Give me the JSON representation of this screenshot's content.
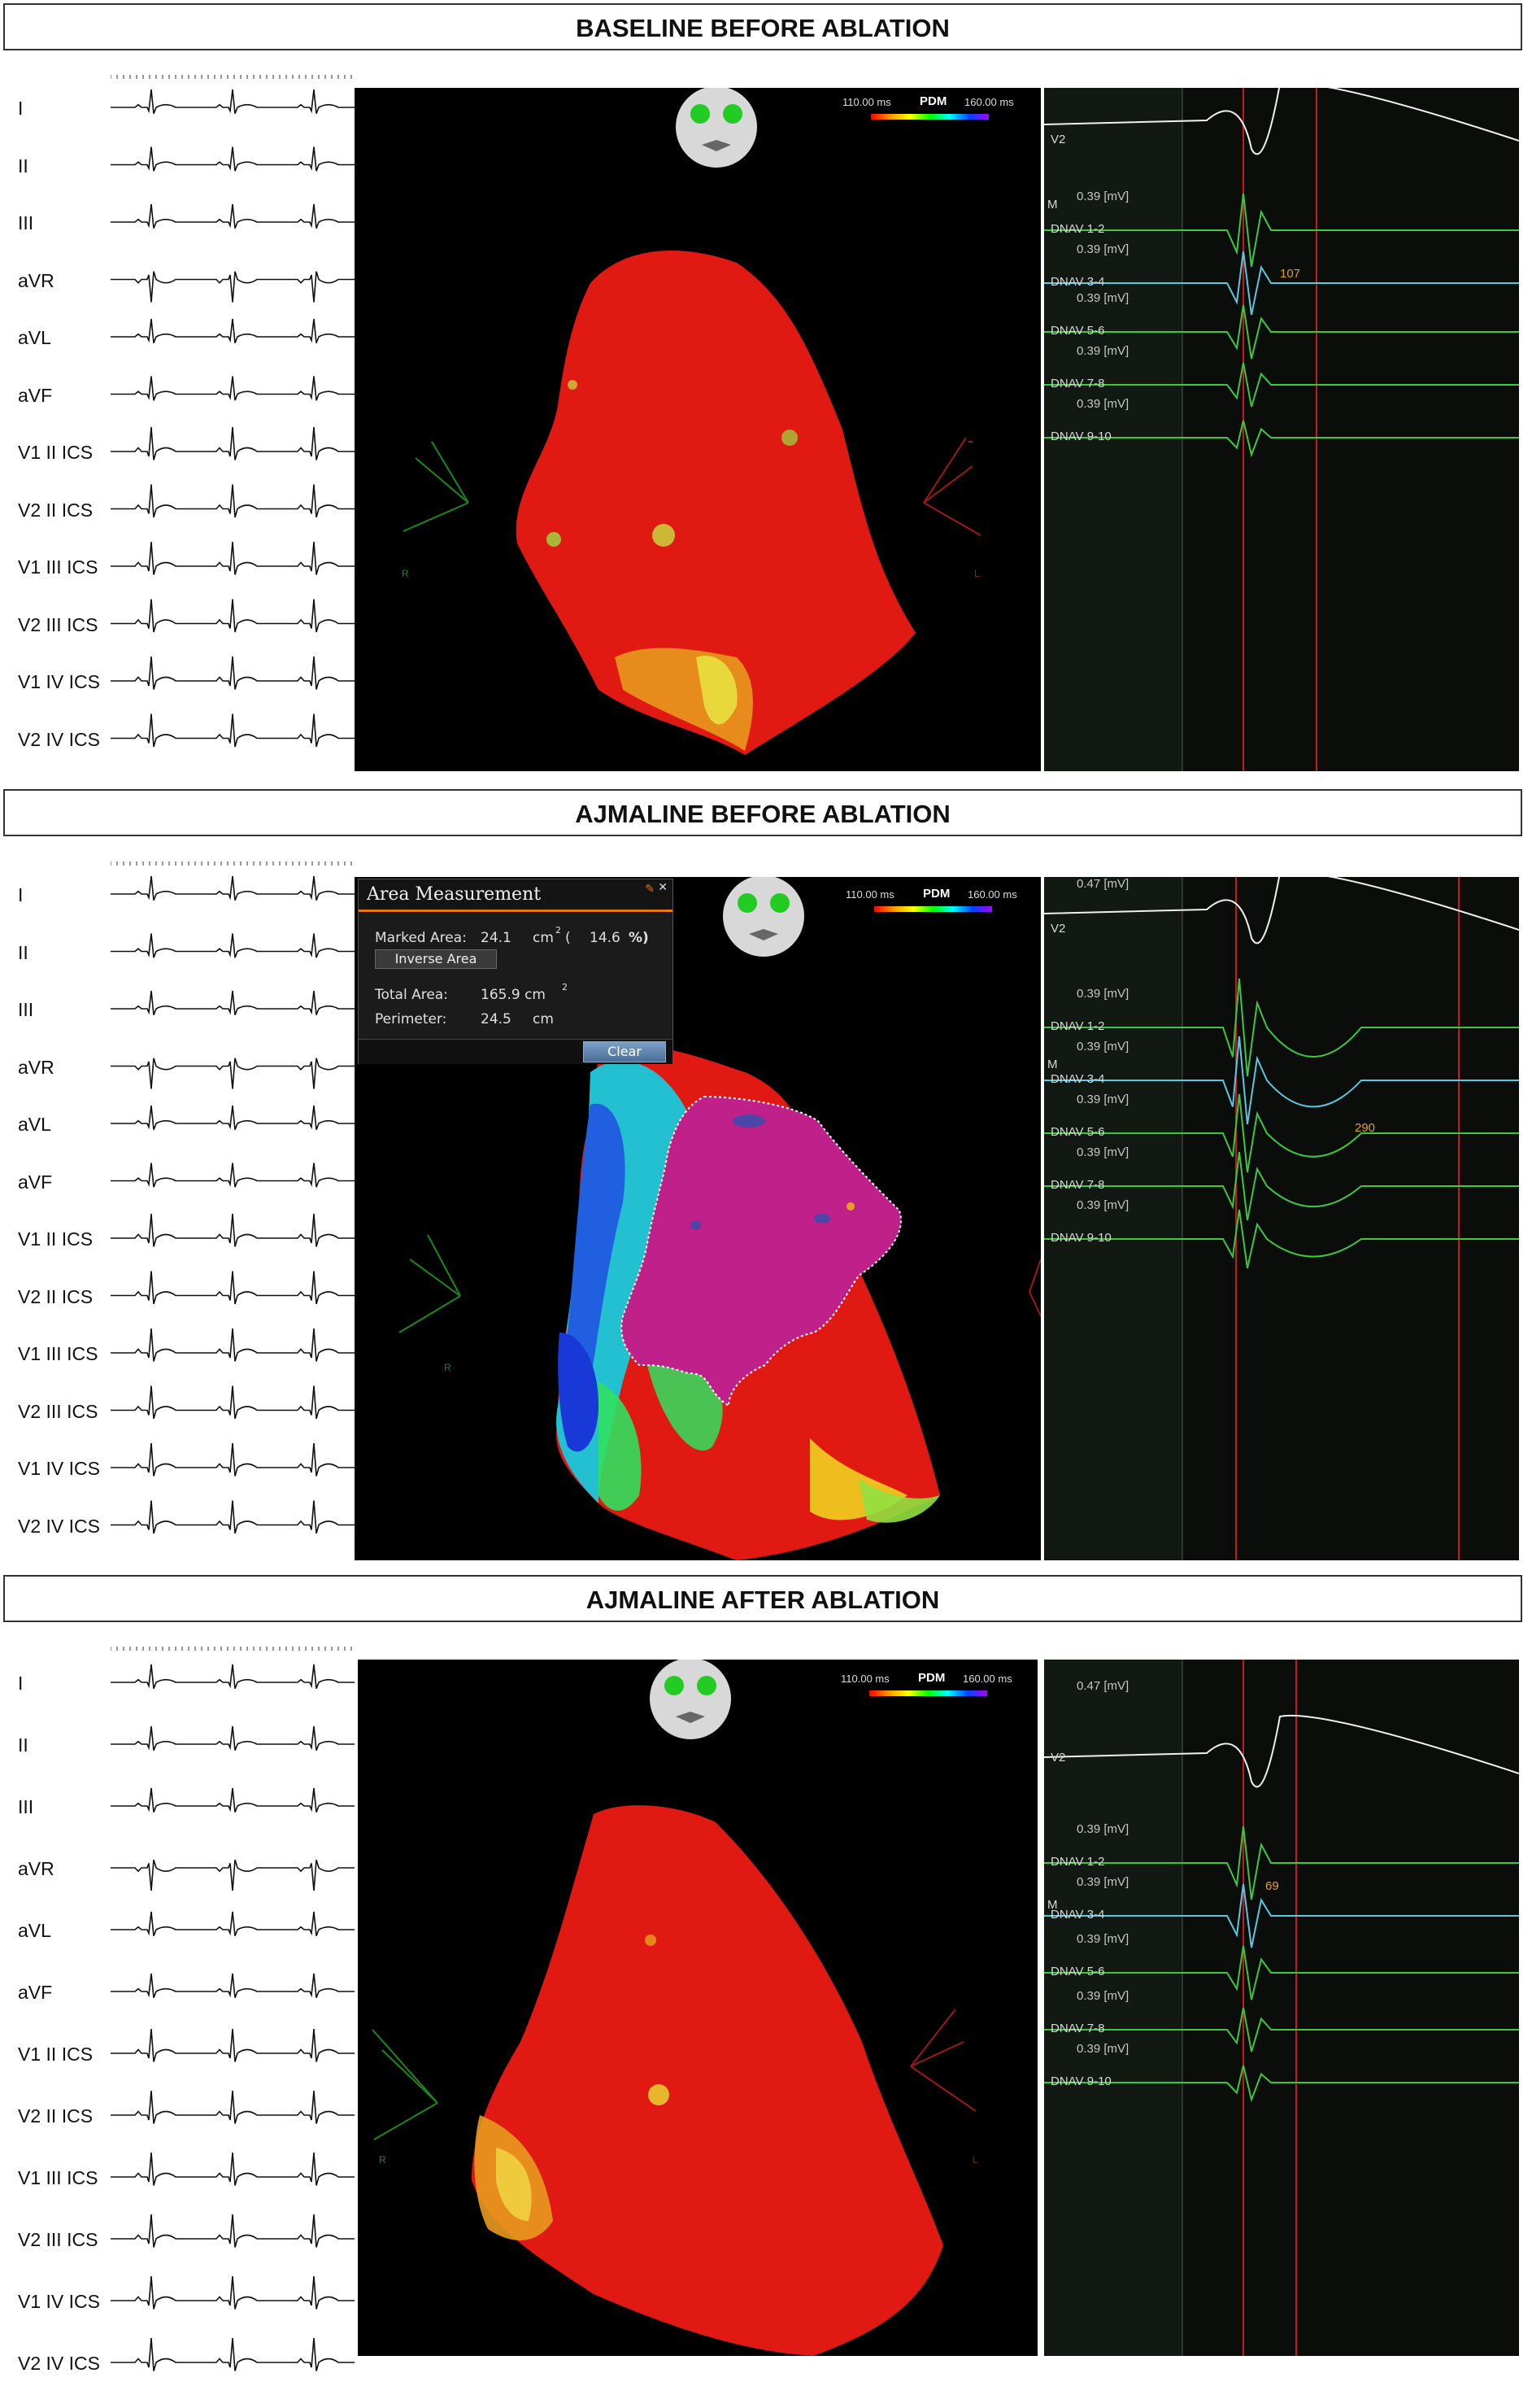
{
  "sections": [
    {
      "title": "BASELINE BEFORE ABLATION",
      "leads": [
        "I",
        "II",
        "III",
        "aVR",
        "aVL",
        "aVF",
        "V1 II ICS",
        "V2 II ICS",
        "V1 III ICS",
        "V2 III ICS",
        "V1 IV ICS",
        "V2 IV ICS"
      ],
      "map": {
        "pdm_label": "PDM",
        "scale_min": "110.00 ms",
        "scale_max": "160.00 ms",
        "left_axis": "R",
        "right_axis": "L"
      },
      "egm": {
        "gain_label": "0.39  [mV]",
        "top_channel": "V2",
        "marker": "M",
        "channels": [
          "DNAV 1-2",
          "DNAV 3-4",
          "DNAV 5-6",
          "DNAV 7-8",
          "DNAV 9-10"
        ],
        "interval": "107"
      }
    },
    {
      "title": "AJMALINE BEFORE ABLATION",
      "leads": [
        "I",
        "II",
        "III",
        "aVR",
        "aVL",
        "aVF",
        "V1 II ICS",
        "V2 II ICS",
        "V1 III ICS",
        "V2 III ICS",
        "V1 IV ICS",
        "V2 IV ICS"
      ],
      "map": {
        "pdm_label": "PDM",
        "scale_min": "110.00 ms",
        "scale_max": "160.00 ms",
        "left_axis": "R"
      },
      "popup": {
        "title": "Area Measurement",
        "marked_area_label": "Marked Area:",
        "marked_area_value": "24.1",
        "marked_area_unit": "cm",
        "marked_area_pct": "14.6",
        "inverse_button": "Inverse Area",
        "total_area_label": "Total Area:",
        "total_area_value": "165.9 cm",
        "perimeter_label": "Perimeter:",
        "perimeter_value": "24.5",
        "perimeter_unit": "cm",
        "clear_button": "Clear"
      },
      "egm": {
        "gain_top": "0.47  [mV]",
        "gain_label": "0.39  [mV]",
        "top_channel": "V2",
        "marker": "M",
        "channels": [
          "DNAV 1-2",
          "DNAV 3-4",
          "DNAV 5-6",
          "DNAV 7-8",
          "DNAV 9-10"
        ],
        "interval": "290"
      }
    },
    {
      "title": "AJMALINE AFTER ABLATION",
      "leads": [
        "I",
        "II",
        "III",
        "aVR",
        "aVL",
        "aVF",
        "V1 II ICS",
        "V2 II ICS",
        "V1 III ICS",
        "V2 III ICS",
        "V1 IV ICS",
        "V2 IV ICS"
      ],
      "map": {
        "pdm_label": "PDM",
        "scale_min": "110.00 ms",
        "scale_max": "160.00 ms",
        "left_axis": "R",
        "right_axis": "L"
      },
      "egm": {
        "gain_top": "0.47  [mV]",
        "gain_label": "0.39  [mV]",
        "top_channel": "V2",
        "marker": "M",
        "channels": [
          "DNAV 1-2",
          "DNAV 3-4",
          "DNAV 5-6",
          "DNAV 7-8",
          "DNAV 9-10"
        ],
        "interval": "69"
      }
    }
  ]
}
